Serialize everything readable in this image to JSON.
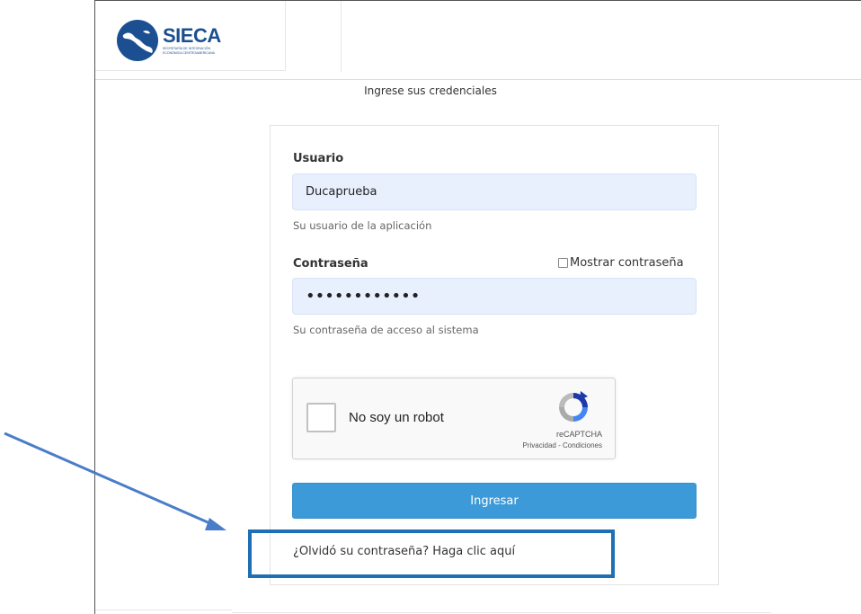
{
  "header": {
    "logo_name": "SIECA",
    "logo_subtitle_line1": "SECRETARÍA DE INTEGRACIÓN",
    "logo_subtitle_line2": "ECONÓMICA CENTROAMERICANA"
  },
  "page": {
    "subtitle": "Ingrese sus credenciales"
  },
  "form": {
    "username_label": "Usuario",
    "username_value": "Ducaprueba",
    "username_help": "Su usuario de la aplicación",
    "password_label": "Contraseña",
    "show_password_label": "Mostrar contraseña",
    "show_password_checked": false,
    "password_mask": "••••••••••••",
    "password_help": "Su contraseña de acceso al sistema",
    "submit_label": "Ingresar",
    "forgot_link": "¿Olvidó su contraseña? Haga clic aquí"
  },
  "captcha": {
    "label": "No soy un robot",
    "brand": "reCAPTCHA",
    "links": "Privacidad - Condiciones",
    "checked": false
  },
  "annotation": {
    "color": "#1f6fb5",
    "shape": "arrow-and-highlight-box"
  },
  "colors": {
    "brand_blue": "#1b4f91",
    "input_background": "#e8f0fe",
    "button_blue": "#3d9ad8"
  }
}
